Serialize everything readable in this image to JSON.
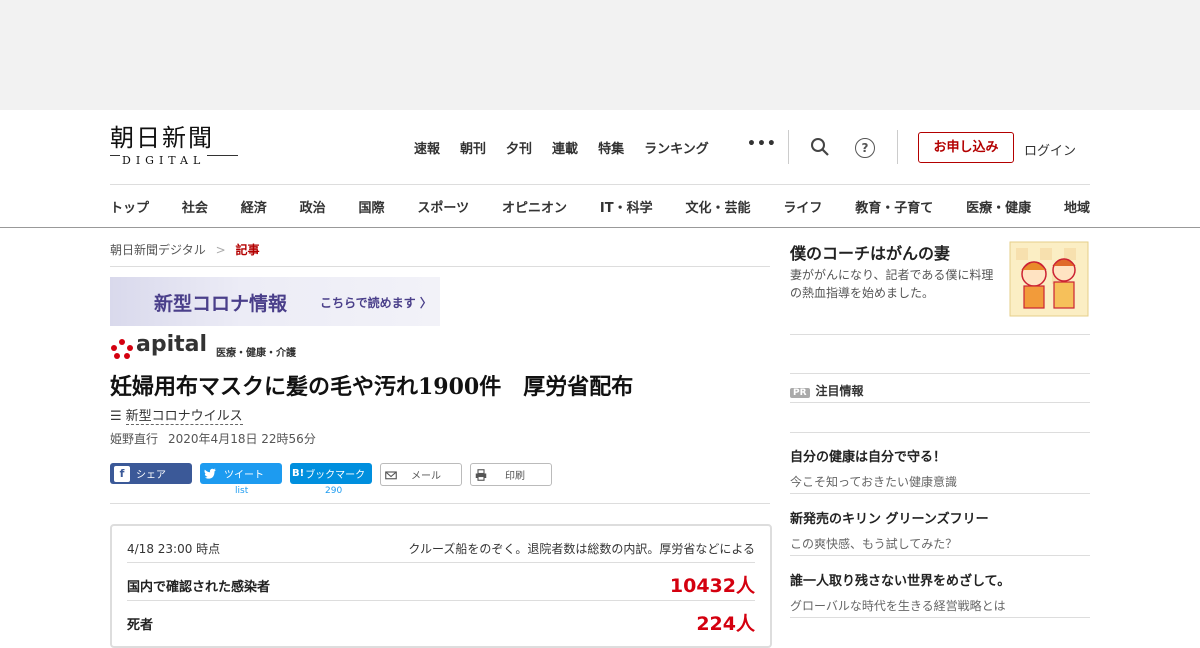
{
  "header": {
    "logo_kanji": "朝日新聞",
    "logo_latin": "DIGITAL",
    "top_nav": [
      "速報",
      "朝刊",
      "夕刊",
      "連載",
      "特集",
      "ランキング"
    ],
    "more_label": "•••",
    "help_label": "?",
    "apply_label": "お申し込み",
    "login_label": "ログイン"
  },
  "categories": [
    "トップ",
    "社会",
    "経済",
    "政治",
    "国際",
    "スポーツ",
    "オピニオン",
    "IT・科学",
    "文化・芸能",
    "ライフ",
    "教育・子育て",
    "医療・健康",
    "地域"
  ],
  "breadcrumb": {
    "home": "朝日新聞デジタル",
    "sep": ">",
    "current": "記事"
  },
  "banner": {
    "title": "新型コロナ情報",
    "sub": "こちらで読めます 〉"
  },
  "apital": {
    "word": "apital",
    "sub": "医療・健康・介護"
  },
  "article": {
    "headline": "妊婦用布マスクに髪の毛や汚れ1900件　厚労省配布",
    "topic_icon": "☰",
    "topic": "新型コロナウイルス",
    "author": "姫野直行",
    "date": "2020年4月18日 22時56分"
  },
  "share": {
    "facebook": "シェア",
    "twitter": "ツイート",
    "twitter_count": "list",
    "hatena": "ブックマーク",
    "hatena_icon": "B!",
    "hatena_count": "290",
    "mail": "メール",
    "print": "印刷"
  },
  "stats": {
    "time": "4/18 23:00 時点",
    "note": "クルーズ船をのぞく。退院者数は総数の内訳。厚労省などによる",
    "rows": [
      {
        "label": "国内で確認された感染者",
        "value": "10432人"
      },
      {
        "label": "死者",
        "value": "224人"
      }
    ]
  },
  "sidebar": {
    "feature_title": "僕のコーチはがんの妻",
    "feature_desc": "妻ががんになり、記者である僕に料理の熱血指導を始めました。",
    "pr_badge": "PR",
    "pr_heading": "注目情報",
    "pr_items": [
      {
        "title": "自分の健康は自分で守る！",
        "desc": "今こそ知っておきたい健康意識"
      },
      {
        "title": "新発売のキリン グリーンズフリー",
        "desc": "この爽快感、もう試してみた？"
      },
      {
        "title": "誰一人取り残さない世界をめざして。",
        "desc": "グローバルな時代を生きる経営戦略とは"
      }
    ]
  },
  "colors": {
    "brand_red": "#b30000",
    "stat_red": "#d4000f",
    "facebook": "#3b5998",
    "twitter": "#1d9bf0",
    "hatena": "#008fde"
  }
}
